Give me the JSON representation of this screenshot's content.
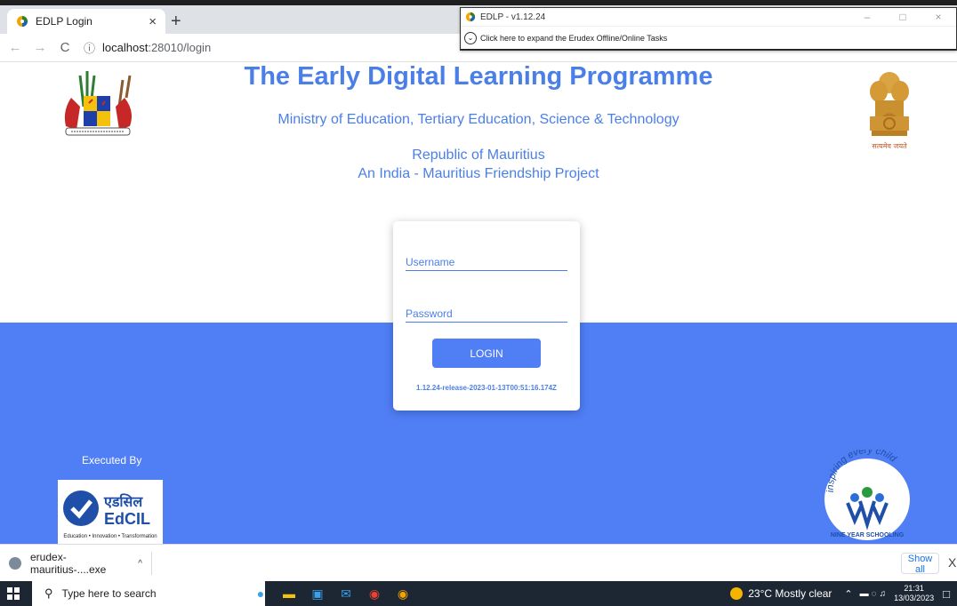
{
  "browser": {
    "tab_title": "EDLP Login",
    "tab_close": "×",
    "new_tab": "+",
    "back": "←",
    "forward": "→",
    "reload": "C",
    "info_icon": "ⓘ",
    "url_host": "localhost",
    "url_rest": ":28010/login"
  },
  "overlay": {
    "title": "EDLP - v1.12.24",
    "minimize": "–",
    "maximize": "□",
    "close": "×",
    "expand_label": "Click here to expand the Erudex Offline/Online Tasks"
  },
  "page": {
    "title": "The Early Digital Learning Programme",
    "ministry": "Ministry of Education, Tertiary Education, Science & Technology",
    "republic": "Republic of Mauritius",
    "project": "An India - Mauritius Friendship Project",
    "india_motto": "सत्यमेव जयते",
    "login": {
      "username_placeholder": "Username",
      "password_placeholder": "Password",
      "login_label": "LOGIN",
      "version": "1.12.24-release-2023-01-13T00:51:16.174Z"
    },
    "executed_by": "Executed By",
    "edcil_hindi": "एडसिल",
    "edcil_name": "EdCIL",
    "edcil_tagline": "Education • Innovation • Transformation",
    "nys_slogan": "inspiring every child",
    "nys_label": "NINE YEAR SCHOOLING"
  },
  "downloads": {
    "file_name": "erudex-mauritius-....exe",
    "chevron": "^",
    "show_all": "Show all",
    "close": "X"
  },
  "taskbar": {
    "search_placeholder": "Type here to search",
    "weather": "23°C  Mostly clear",
    "time": "21:31",
    "date": "13/03/2023"
  },
  "colors": {
    "brand_blue": "#4b7fe8",
    "band_blue": "#4f7ef5",
    "taskbar": "#1c2733"
  }
}
